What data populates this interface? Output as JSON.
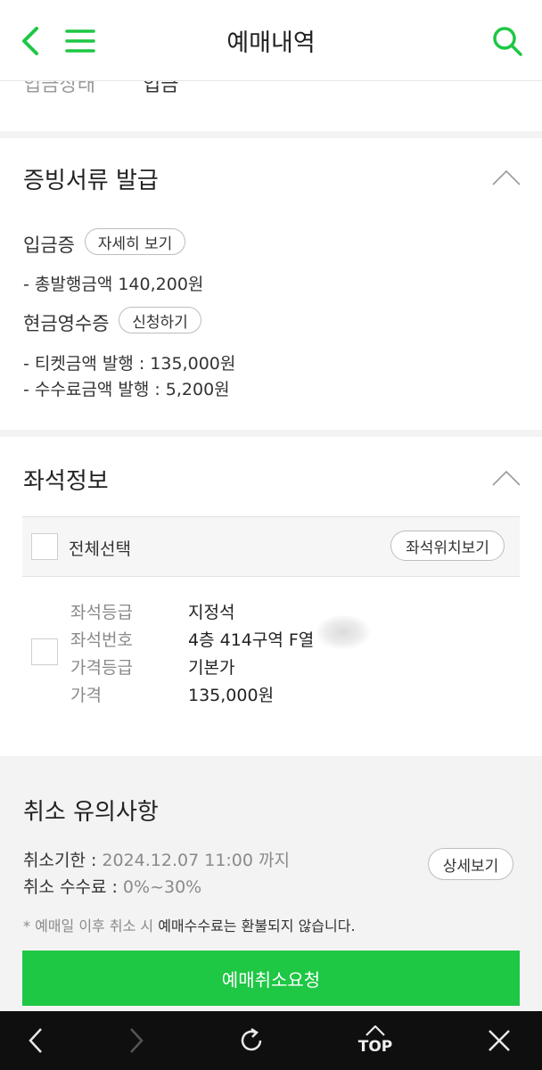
{
  "header": {
    "title": "예매내역",
    "back_icon": "chevron-left-icon",
    "menu_icon": "hamburger-icon",
    "search_icon": "search-icon",
    "accent_color": "#1ec744"
  },
  "deposit_row": {
    "label": "입금상태",
    "value": "입금"
  },
  "certificate": {
    "title": "증빙서류 발급",
    "deposit_receipt_label": "입금증",
    "detail_button": "자세히 보기",
    "total_amount": "- 총발행금액 140,200원",
    "cash_receipt_label": "현금영수증",
    "apply_button": "신청하기",
    "ticket_amount": "- 티켓금액 발행 : 135,000원",
    "fee_amount": "- 수수료금액 발행 : 5,200원"
  },
  "seat": {
    "title": "좌석정보",
    "select_all": "전체선택",
    "seat_location_button": "좌석위치보기",
    "rows": [
      {
        "label": "좌석등급",
        "value": "지정석"
      },
      {
        "label": "좌석번호",
        "value": "4층 414구역 F열"
      },
      {
        "label": "가격등급",
        "value": "기본가"
      },
      {
        "label": "가격",
        "value": "135,000원"
      }
    ]
  },
  "cancel": {
    "title": "취소 유의사항",
    "deadline_label": "취소기한 : ",
    "deadline_value": "2024.12.07 11:00 까지",
    "fee_label": "취소 수수료 : ",
    "fee_value": "0%~30%",
    "detail_button": "상세보기",
    "notice_prefix": "* 예매일 이후 취소 시 ",
    "notice_strong": "예매수수료는 환불되지 않습니다.",
    "request_button": "예매취소요청"
  },
  "bottom_nav": {
    "back_icon": "back-arrow-icon",
    "forward_icon": "forward-arrow-icon",
    "refresh_icon": "refresh-icon",
    "top_label": "TOP",
    "close_icon": "close-icon"
  }
}
